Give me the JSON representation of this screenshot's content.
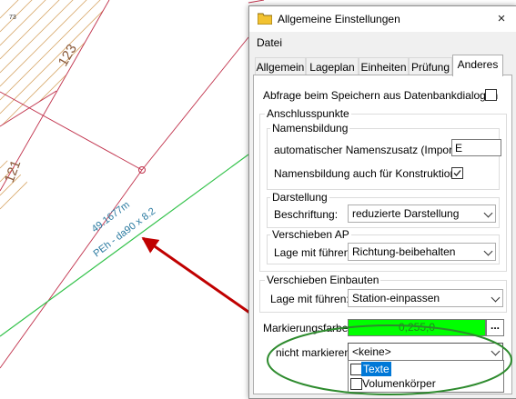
{
  "drawing": {
    "parcel_numbers": [
      "73",
      "123",
      "121"
    ],
    "line_label_1": "49.1677m",
    "line_label_2": "PEh - da90 x 8.2"
  },
  "window": {
    "title": "Allgemeine Einstellungen",
    "close_glyph": "×",
    "menu": {
      "file": "Datei"
    },
    "tabs": [
      {
        "label": "Allgemein"
      },
      {
        "label": "Lageplan"
      },
      {
        "label": "Einheiten"
      },
      {
        "label": "Prüfung"
      },
      {
        "label": "Anderes"
      }
    ],
    "active_tab": "Anderes",
    "content": {
      "save_prompt": {
        "label": "Abfrage beim Speichern aus Datenbankdialogen",
        "checked": false
      },
      "anschlusspunkte": {
        "title": "Anschlusspunkte",
        "namensbildung": {
          "title": "Namensbildung",
          "zusatz_label": "automatischer Namenszusatz (Import)",
          "zusatz_value": "E",
          "konstruktion_label": "Namensbildung auch für Konstruktion",
          "konstruktion_checked": true
        },
        "darstellung": {
          "title": "Darstellung",
          "label": "Beschriftung:",
          "value": "reduzierte Darstellung"
        },
        "verschieben_ap": {
          "title": "Verschieben AP",
          "label": "Lage mit führen:",
          "value": "Richtung-beibehalten"
        }
      },
      "verschieben_einbauten": {
        "title": "Verschieben Einbauten",
        "label": "Lage mit führen:",
        "value": "Station-einpassen"
      },
      "markierungsfarbe": {
        "label": "Markierungsfarbe",
        "value": "0,255,0",
        "color": "#00ff00",
        "button": "..."
      },
      "nicht_markieren": {
        "label": "nicht markieren",
        "value": "<keine>",
        "options": [
          {
            "label": "Texte",
            "checked": false,
            "highlighted": true
          },
          {
            "label": "Volumenkörper",
            "checked": false,
            "highlighted": false
          }
        ]
      }
    }
  },
  "colors": {
    "arrow": "#c00000",
    "highlight_ellipse": "#2e8b2e",
    "parcel_line": "#c0304a",
    "hatch": "#d8a86a",
    "pipe_line": "#33c24a",
    "selection": "#0078d7"
  }
}
